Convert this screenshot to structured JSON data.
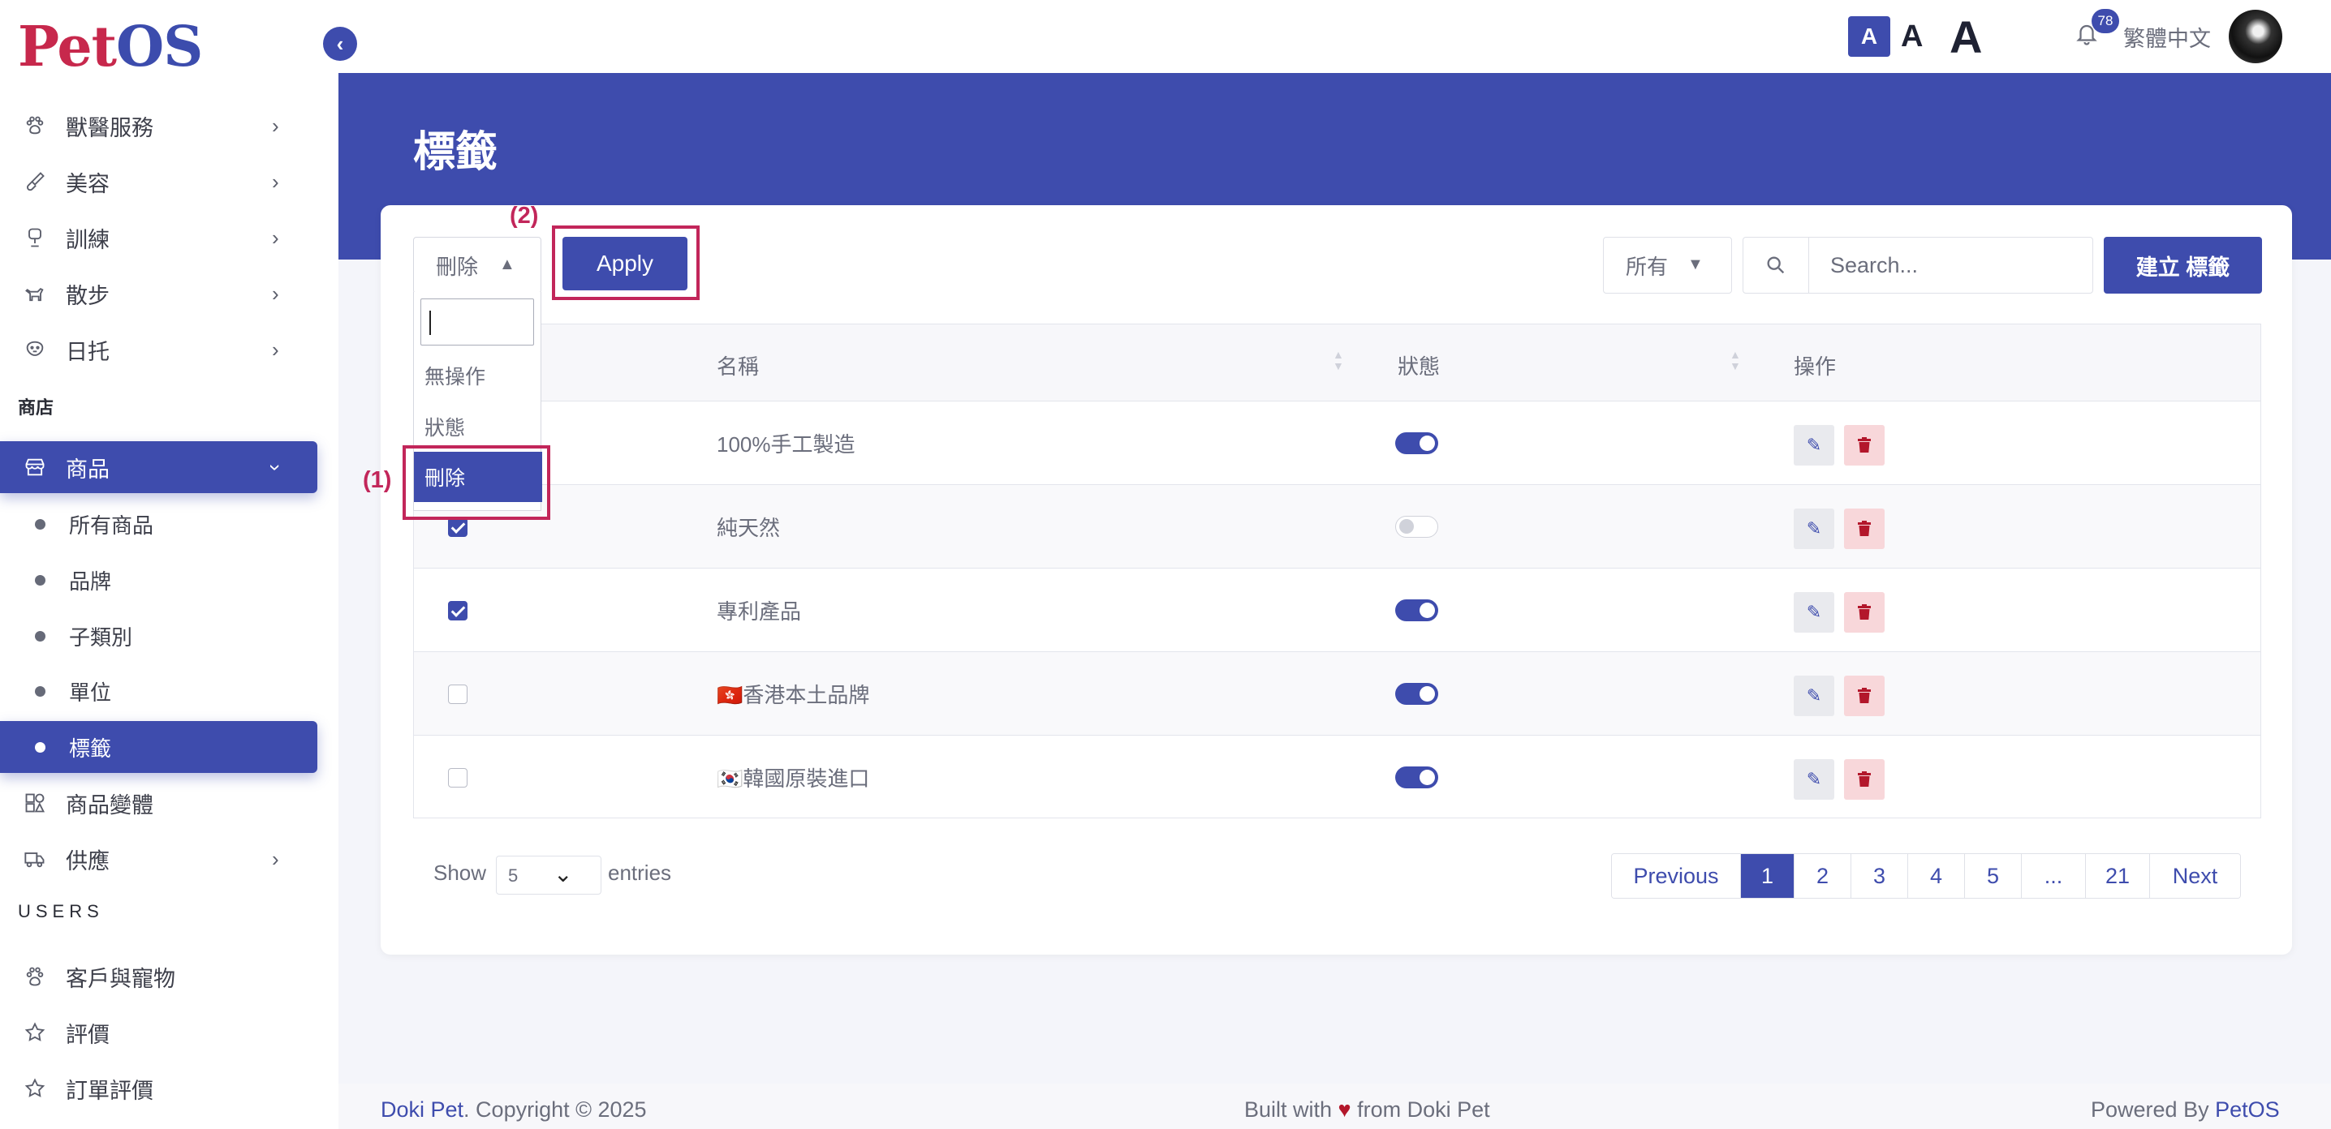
{
  "brand": {
    "logo_p": "P",
    "logo_et": "et",
    "logo_os": "OS"
  },
  "sidebar": {
    "items": [
      {
        "label": "獸醫服務",
        "icon": "paw-medical-icon"
      },
      {
        "label": "美容",
        "icon": "brush-icon"
      },
      {
        "label": "訓練",
        "icon": "trophy-icon"
      },
      {
        "label": "散步",
        "icon": "dog-walk-icon"
      },
      {
        "label": "日托",
        "icon": "daycare-icon"
      }
    ],
    "section_shop": "商店",
    "products_label": "商品",
    "sub_items": [
      "所有商品",
      "品牌",
      "子類別",
      "單位",
      "標籤"
    ],
    "variants_label": "商品變體",
    "supply_label": "供應",
    "section_users": "USERS",
    "customers_label": "客戶與寵物",
    "reviews_label": "評價",
    "order_reviews_label": "訂單評價"
  },
  "header": {
    "font_small": "A",
    "font_medium": "A",
    "font_large": "A",
    "notification_count": "78",
    "language": "繁體中文"
  },
  "page": {
    "title": "標籤"
  },
  "toolbar": {
    "bulk_action_value": "刪除",
    "apply_label": "Apply",
    "filter_value": "所有",
    "search_placeholder": "Search...",
    "create_label": "建立 標籤"
  },
  "bulk_dropdown": {
    "options": [
      "無操作",
      "狀態",
      "刪除"
    ],
    "highlighted": "刪除"
  },
  "annotations": {
    "step1": "(1)",
    "step2": "(2)"
  },
  "table": {
    "columns": {
      "name": "名稱",
      "status": "狀態",
      "actions": "操作"
    },
    "rows": [
      {
        "name": "100%手工製造",
        "checked": false,
        "status_on": true
      },
      {
        "name": "純天然",
        "checked": true,
        "status_on": false
      },
      {
        "name": "專利產品",
        "checked": true,
        "status_on": true
      },
      {
        "name": "🇭🇰香港本土品牌",
        "checked": false,
        "status_on": true
      },
      {
        "name": "🇰🇷韓國原裝進口",
        "checked": false,
        "status_on": true
      }
    ]
  },
  "pagination": {
    "show_label": "Show",
    "entries_value": "5",
    "entries_label": "entries",
    "previous": "Previous",
    "pages": [
      "1",
      "2",
      "3",
      "4",
      "5",
      "...",
      "21"
    ],
    "current": "1",
    "next": "Next"
  },
  "footer": {
    "left_brand": "Doki Pet",
    "left_rest": ". Copyright © 2025",
    "mid_before": "Built with ",
    "mid_heart": "♥",
    "mid_after": " from Doki Pet",
    "right_prefix": "Powered By ",
    "right_brand": "PetOS"
  },
  "colors": {
    "primary": "#3e4cad",
    "annotation": "#c2265a",
    "danger": "#b3172b"
  }
}
